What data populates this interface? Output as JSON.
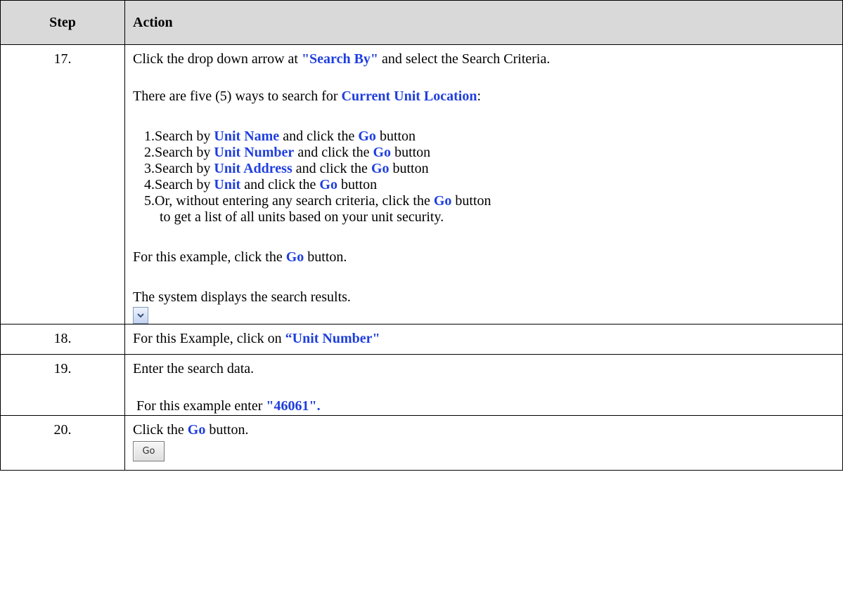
{
  "header": {
    "step": "Step",
    "action": "Action"
  },
  "rows": [
    {
      "step": "17.",
      "intro": {
        "a": "Click the drop down arrow at ",
        "b": "\"Search By\"",
        "c": " and select the Search Criteria."
      },
      "ways": {
        "a": "There are five (5) ways to search for ",
        "b": "Current Unit Location",
        "c": ":"
      },
      "items": [
        {
          "a": "1.Search by ",
          "b": "Unit Name",
          "c": " and click the ",
          "d": "Go",
          "e": " button"
        },
        {
          "a": "2.Search by ",
          "b": "Unit Number",
          "c": " and click the ",
          "d": "Go",
          "e": " button"
        },
        {
          "a": "3.Search by ",
          "b": "Unit Address",
          "c": " and click the ",
          "d": "Go",
          "e": " button"
        },
        {
          "a": "4.Search by ",
          "b": "Unit",
          "c": " and click the ",
          "d": "Go",
          "e": " button"
        },
        {
          "a": "5.Or, without entering any search criteria, click the ",
          "b": "Go",
          "c": " button"
        }
      ],
      "item5_cont": "to get a list of all units based on your unit security.",
      "example": {
        "a": "For this example, click the ",
        "b": "Go",
        "c": " button."
      },
      "result": "The system displays the search results.",
      "button_icon": "chevron-down-icon"
    },
    {
      "step": "18.",
      "text": {
        "a": "For this Example, click on ",
        "b": "“Unit Number\""
      }
    },
    {
      "step": "19.",
      "text1": "Enter the search data.",
      "text2": {
        "a": " For this example enter ",
        "b": "\"46061\"."
      }
    },
    {
      "step": "20.",
      "text": {
        "a": "Click the ",
        "b": "Go",
        "c": " button."
      },
      "go_label": "Go"
    }
  ],
  "colors": {
    "accent": "#1f3fde",
    "header_bg": "#d9d9d9"
  }
}
